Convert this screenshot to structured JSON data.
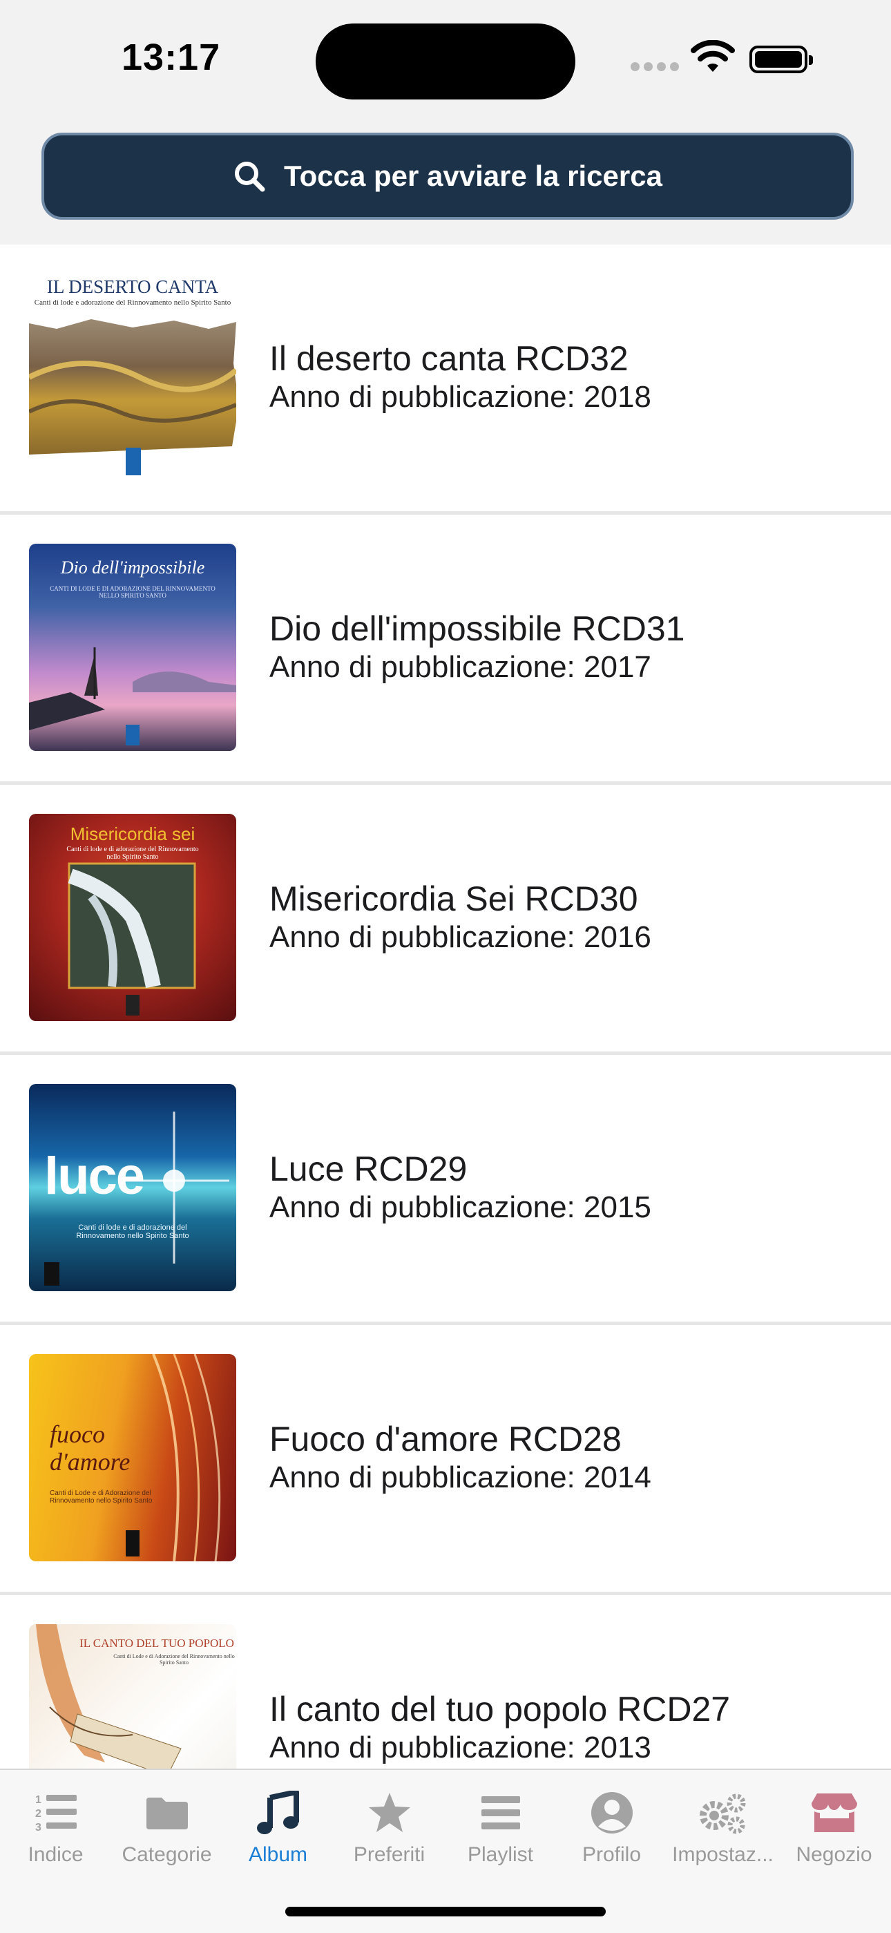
{
  "status_bar": {
    "time": "13:17"
  },
  "search": {
    "placeholder": "Tocca per avviare la ricerca"
  },
  "albums": [
    {
      "title": "Il deserto canta RCD32",
      "year_text": "Anno di pubblicazione: 2018",
      "cover_title": "IL DESERTO CANTA",
      "cover_sub": "Canti di lode e adorazione del Rinnovamento nello Spirito Santo"
    },
    {
      "title": "Dio dell'impossibile RCD31",
      "year_text": "Anno di pubblicazione: 2017",
      "cover_title": "Dio dell'impossibile",
      "cover_sub": "CANTI DI LODE E DI ADORAZIONE DEL RINNOVAMENTO NELLO SPIRITO SANTO"
    },
    {
      "title": "Misericordia Sei RCD30",
      "year_text": "Anno di pubblicazione: 2016",
      "cover_title": "Misericordia sei",
      "cover_sub": "Canti di lode e di adorazione del Rinnovamento nello Spirito Santo"
    },
    {
      "title": "Luce RCD29",
      "year_text": "Anno di pubblicazione: 2015",
      "cover_title": "luce",
      "cover_sub": "Canti di lode e di adorazione del Rinnovamento nello Spirito Santo"
    },
    {
      "title": "Fuoco d'amore RCD28",
      "year_text": "Anno di pubblicazione: 2014",
      "cover_title": "fuoco d'amore",
      "cover_sub": "Canti di Lode e di Adorazione del Rinnovamento nello Spirito Santo"
    },
    {
      "title": "Il canto del tuo popolo RCD27",
      "year_text": "Anno di pubblicazione: 2013",
      "cover_title": "IL CANTO DEL TUO POPOLO",
      "cover_sub": "Canti di Lode e di Adorazione del Rinnovamento nello Spirito Santo"
    }
  ],
  "tabs": [
    {
      "label": "Indice",
      "icon": "numbered-list-icon",
      "active": false
    },
    {
      "label": "Categorie",
      "icon": "folder-icon",
      "active": false
    },
    {
      "label": "Album",
      "icon": "music-note-icon",
      "active": true
    },
    {
      "label": "Preferiti",
      "icon": "star-icon",
      "active": false
    },
    {
      "label": "Playlist",
      "icon": "playlist-icon",
      "active": false
    },
    {
      "label": "Profilo",
      "icon": "user-icon",
      "active": false
    },
    {
      "label": "Impostaz...",
      "icon": "gears-icon",
      "active": false
    },
    {
      "label": "Negozio",
      "icon": "store-icon",
      "active": false
    }
  ],
  "colors": {
    "search_bg": "#1c3249",
    "active_tab": "#1c7fd6",
    "inactive_tab": "#9a9a9a",
    "store_tab": "#c9788a"
  }
}
